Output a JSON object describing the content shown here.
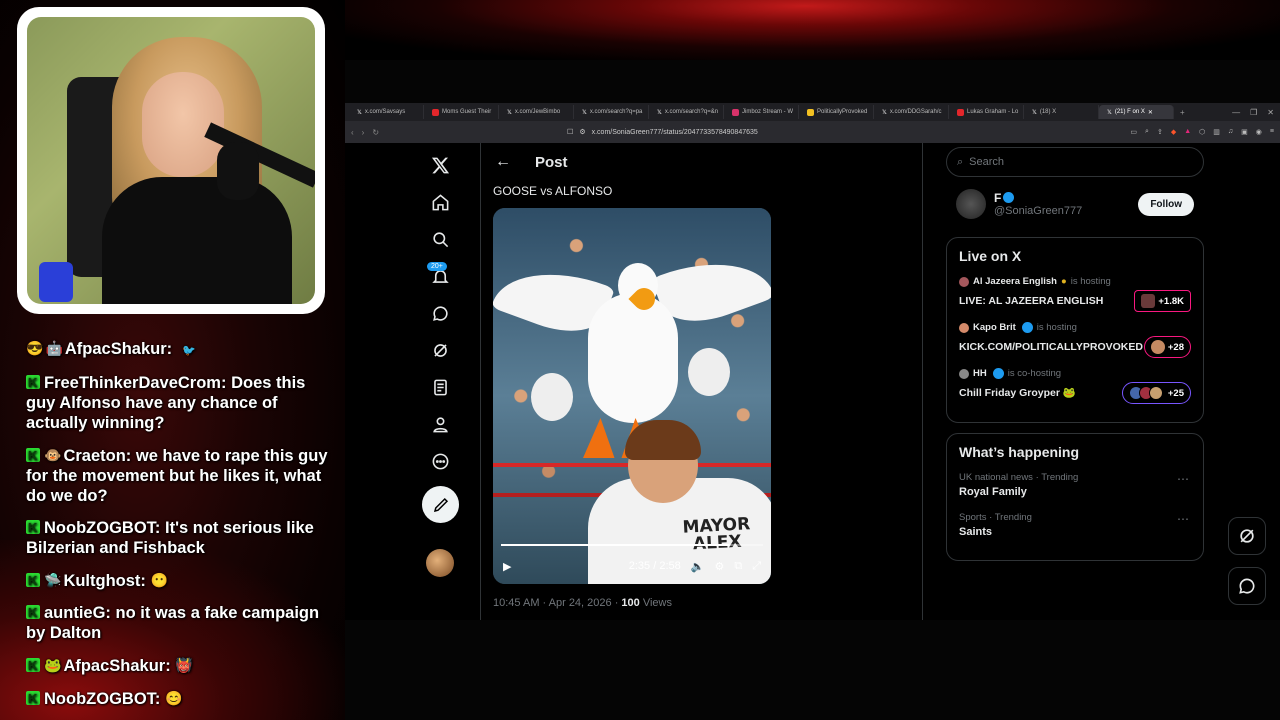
{
  "chat": {
    "messages": [
      {
        "user": "AfpacShakur:",
        "text": "",
        "emote": "🐦"
      },
      {
        "user": "FreeThinkerDaveCrom:",
        "text": "Does this guy Alfonso have any chance of actually winning?"
      },
      {
        "user": "Craeton:",
        "text": "we have to rape this guy for the movement but he likes it, what do we do?"
      },
      {
        "user": "NoobZOGBOT:",
        "text": "It's not serious like Bilzerian and Fishback"
      },
      {
        "user": "Kultghost:",
        "text": "",
        "emote": "😶"
      },
      {
        "user": "auntieG:",
        "text": "no it was a fake campaign by Dalton"
      },
      {
        "user": "AfpacShakur:",
        "text": "",
        "emote": "👹"
      },
      {
        "user": "NoobZOGBOT:",
        "text": "",
        "emote": "😊"
      }
    ]
  },
  "browser": {
    "tabs": [
      {
        "label": "x.com/Savsays",
        "icon": "x-icon"
      },
      {
        "label": "Moms Guest Their",
        "icon": "youtube-icon"
      },
      {
        "label": "x.com/JewBimbo",
        "icon": "x-icon"
      },
      {
        "label": "x.com/search?q=pa",
        "icon": "x-icon"
      },
      {
        "label": "x.com/search?q=&n",
        "icon": "x-icon"
      },
      {
        "label": "Jimboz Stream - W",
        "icon": "stream-icon"
      },
      {
        "label": "PoliticallyProvoked",
        "icon": "stream-icon"
      },
      {
        "label": "x.com/DDGSarah/c",
        "icon": "x-icon"
      },
      {
        "label": "Lukas Graham - Lo",
        "icon": "youtube-icon"
      },
      {
        "label": "(18) X",
        "icon": "x-icon"
      },
      {
        "label": "(21) F on X",
        "icon": "x-icon",
        "active": true
      }
    ],
    "url": "x.com/SoniaGreen777/status/2047733578490847635"
  },
  "x": {
    "notif_count": "20+",
    "post_header": "Post",
    "post_text": "GOOSE vs ALFONSO",
    "video": {
      "shirt_line1": "MAYOR",
      "shirt_line2": "ALEX",
      "time": "2:35 / 2:58",
      "progress": 0.87
    },
    "post_time": "10:45 AM · Apr 24, 2026 · ",
    "post_views_count": "100",
    "post_views_label": " Views",
    "search_placeholder": "Search",
    "profile": {
      "name": "F",
      "handle": "@SoniaGreen777",
      "follow_label": "Follow"
    },
    "live_title": "Live on X",
    "live": [
      {
        "host": "Al Jazeera English",
        "status": "is hosting",
        "title": "LIVE: AL JAZEERA ENGLISH",
        "count": "+1.8K"
      },
      {
        "host": "Kapo Brit",
        "status": "is hosting",
        "title": "KICK.COM/POLITICALLYPROVOKED",
        "count": "+28"
      },
      {
        "host": "HH",
        "status": "is co-hosting",
        "title": "Chill Friday Groyper 🐸",
        "count": "+25"
      }
    ],
    "happening_title": "What’s happening",
    "trends": [
      {
        "meta": "UK national news · Trending",
        "name": "Royal Family"
      },
      {
        "meta": "Sports · Trending",
        "name": "Saints"
      }
    ]
  },
  "colors": {
    "accent": "#1d9bf0",
    "live_pink": "#f91880",
    "kick_green": "#2bdc32"
  }
}
